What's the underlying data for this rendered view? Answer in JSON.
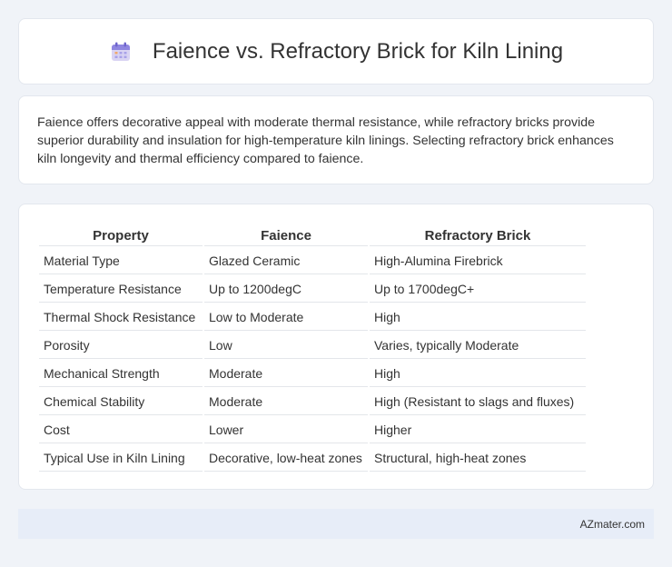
{
  "header": {
    "title": "Faience vs. Refractory Brick for Kiln Lining",
    "icon": "calendar-icon"
  },
  "summary": {
    "text": "Faience offers decorative appeal with moderate thermal resistance, while refractory bricks provide superior durability and insulation for high-temperature kiln linings. Selecting refractory brick enhances kiln longevity and thermal efficiency compared to faience."
  },
  "table": {
    "headers": [
      "Property",
      "Faience",
      "Refractory Brick"
    ],
    "rows": [
      [
        "Material Type",
        "Glazed Ceramic",
        "High-Alumina Firebrick"
      ],
      [
        "Temperature Resistance",
        "Up to 1200degC",
        "Up to 1700degC+"
      ],
      [
        "Thermal Shock Resistance",
        "Low to Moderate",
        "High"
      ],
      [
        "Porosity",
        "Low",
        "Varies, typically Moderate"
      ],
      [
        "Mechanical Strength",
        "Moderate",
        "High"
      ],
      [
        "Chemical Stability",
        "Moderate",
        "High (Resistant to slags and fluxes)"
      ],
      [
        "Cost",
        "Lower",
        "Higher"
      ],
      [
        "Typical Use in Kiln Lining",
        "Decorative, low-heat zones",
        "Structural, high-heat zones"
      ]
    ]
  },
  "footer": {
    "text": "AZmater.com"
  },
  "colors": {
    "background": "#f0f3f8",
    "card": "#ffffff",
    "footer": "#e7edf8"
  }
}
